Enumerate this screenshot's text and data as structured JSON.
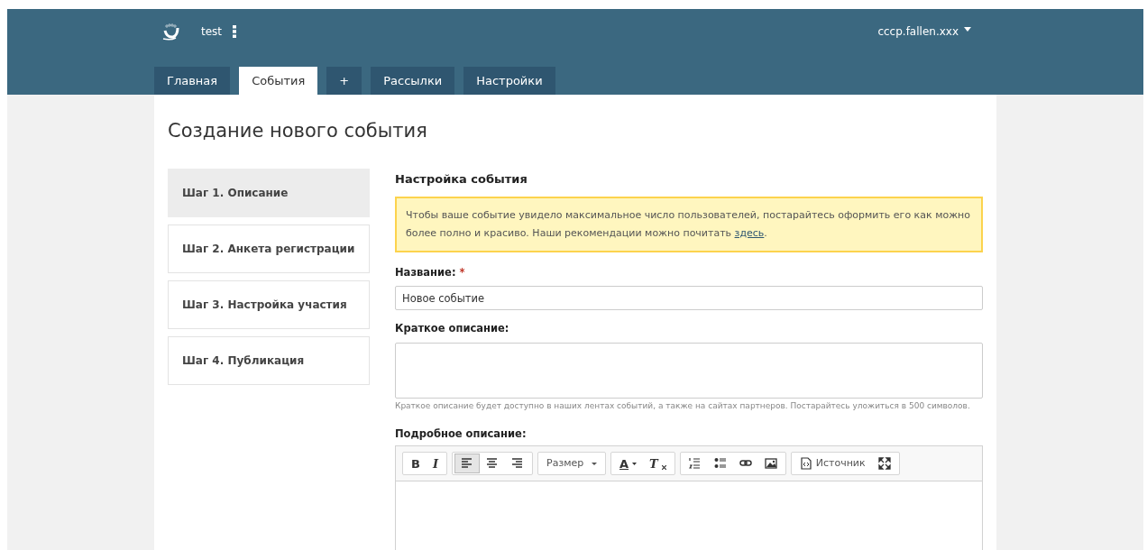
{
  "header": {
    "site": "test",
    "user": "cccp.fallen.xxx"
  },
  "tabs": [
    {
      "label": "Главная",
      "selected": false
    },
    {
      "label": "События",
      "selected": true
    },
    {
      "label": "+",
      "selected": false
    },
    {
      "label": "Рассылки",
      "selected": false
    },
    {
      "label": "Настройки",
      "selected": false
    }
  ],
  "page_title": "Создание нового события",
  "steps": [
    {
      "label": "Шаг 1. Описание",
      "selected": true
    },
    {
      "label": "Шаг 2. Анкета регистрации",
      "selected": false
    },
    {
      "label": "Шаг 3. Настройка участия",
      "selected": false
    },
    {
      "label": "Шаг 4. Публикация",
      "selected": false
    }
  ],
  "section_title": "Настройка события",
  "notice": {
    "text": "Чтобы ваше событие увидело максимальное число пользователей, постарайтесь оформить его как можно более полно и красиво. Наши рекомендации можно почитать ",
    "link": "здесь",
    "end": "."
  },
  "name_field": {
    "label": "Название:",
    "required_mark": "*",
    "value": "Новое событие"
  },
  "short_field": {
    "label": "Краткое описание:",
    "hint": "Краткое описание будет доступно в наших лентах событий, а также на сайтах партнеров. Постарайтесь уложиться в 500 символов."
  },
  "long_field": {
    "label": "Подробное описание:"
  },
  "toolbar": [
    [
      {
        "kind": "bold",
        "label": "B",
        "selected": false
      },
      {
        "kind": "italic",
        "label": "I",
        "selected": false
      }
    ],
    [
      {
        "kind": "align-left",
        "selected": true
      },
      {
        "kind": "align-center",
        "selected": false
      },
      {
        "kind": "align-right",
        "selected": false
      }
    ],
    [
      {
        "kind": "dropdown",
        "label": "Размер",
        "selected": false
      }
    ],
    [
      {
        "kind": "text-color",
        "label": "A",
        "selected": false
      },
      {
        "kind": "remove-format",
        "label": "T",
        "selected": false
      }
    ],
    [
      {
        "kind": "numbered-list",
        "selected": false
      },
      {
        "kind": "bulleted-list",
        "selected": false
      },
      {
        "kind": "link",
        "selected": false
      },
      {
        "kind": "image",
        "selected": false
      }
    ],
    [
      {
        "kind": "source",
        "label": "Источник",
        "selected": false
      },
      {
        "kind": "maximize",
        "selected": false
      }
    ]
  ]
}
